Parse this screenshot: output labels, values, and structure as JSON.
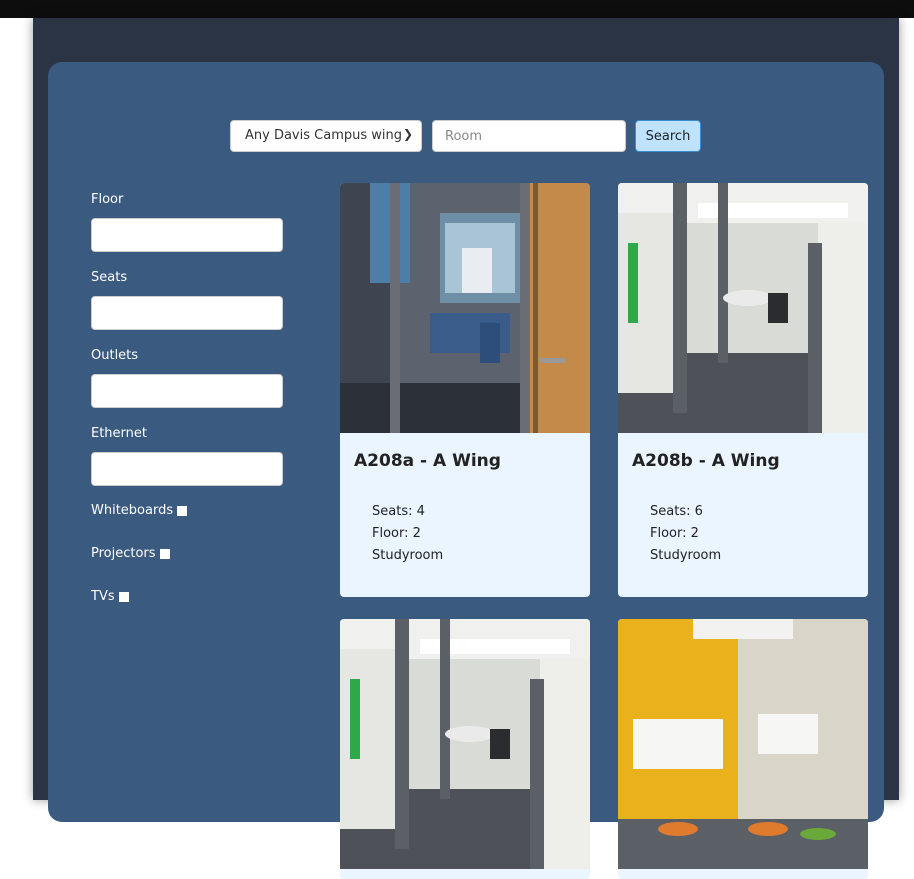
{
  "search": {
    "wing_select_value": "Any Davis Campus wing",
    "room_placeholder": "Room",
    "button_label": "Search"
  },
  "filters": {
    "floor_label": "Floor",
    "seats_label": "Seats",
    "outlets_label": "Outlets",
    "ethernet_label": "Ethernet",
    "whiteboards_label": "Whiteboards",
    "projectors_label": "Projectors",
    "tvs_label": "TVs"
  },
  "rooms": [
    {
      "title": "A208a - A Wing",
      "seats": "Seats: 4",
      "floor": "Floor: 2",
      "type": "Studyroom"
    },
    {
      "title": "A208b - A Wing",
      "seats": "Seats: 6",
      "floor": "Floor: 2",
      "type": "Studyroom"
    },
    {
      "title": "",
      "seats": "",
      "floor": "",
      "type": ""
    },
    {
      "title": "",
      "seats": "",
      "floor": "",
      "type": ""
    }
  ]
}
